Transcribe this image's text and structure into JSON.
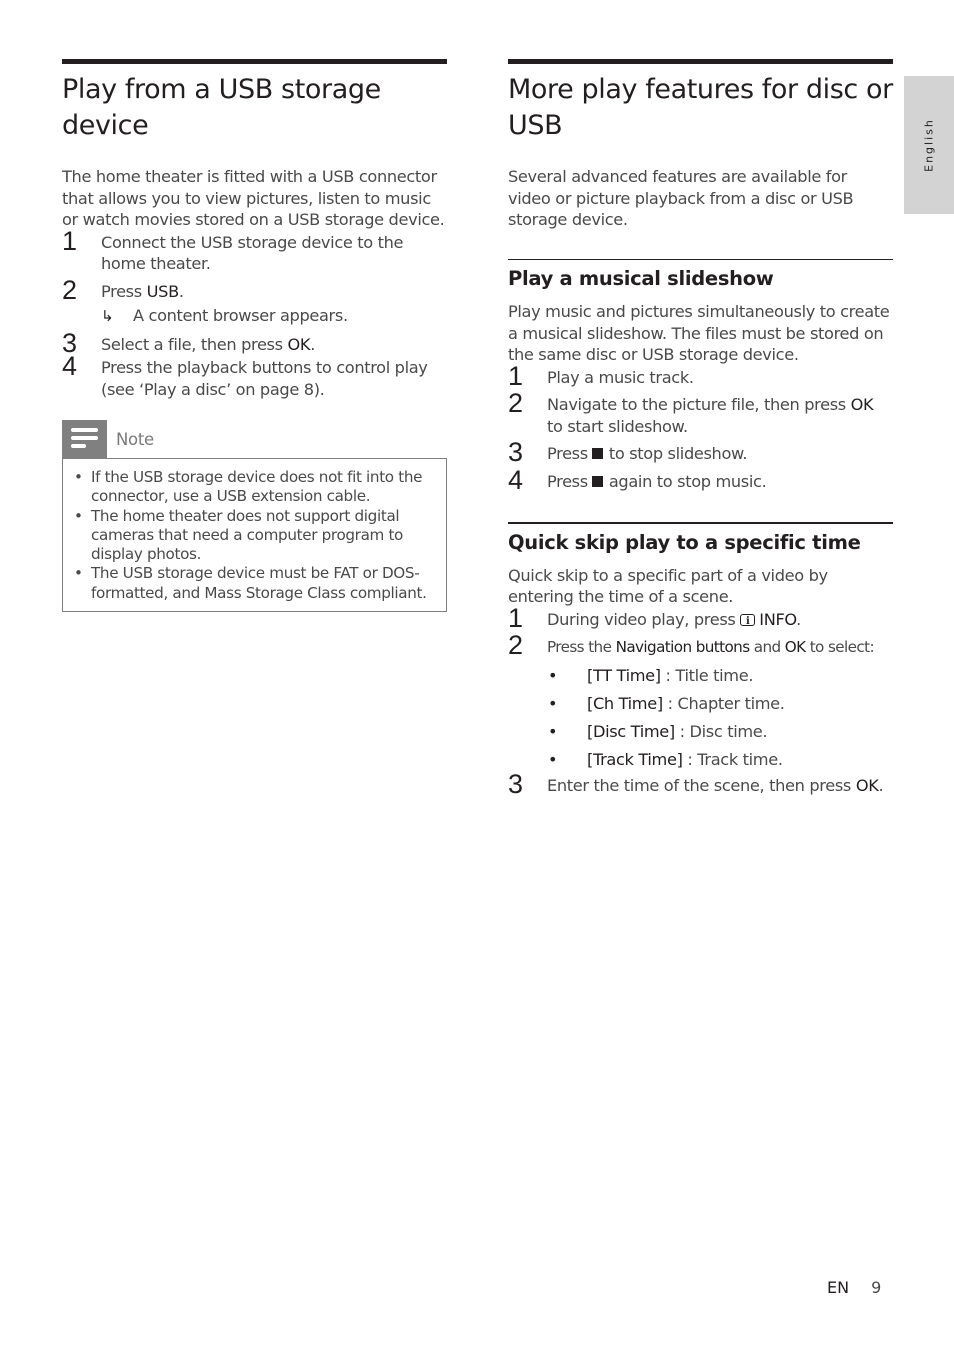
{
  "left": {
    "title": "Play from a USB storage device",
    "intro": "The home theater is fitted with a USB connector that allows you to view pictures, listen to music or watch movies stored on a USB storage device.",
    "steps": [
      {
        "num": "1",
        "text": "Connect the USB storage device to the home theater."
      },
      {
        "num": "2",
        "pre": "Press ",
        "bold": "USB",
        "post": ".",
        "result": "A content browser appears."
      },
      {
        "num": "3",
        "pre": "Select a file, then press ",
        "bold": "OK",
        "post": "."
      },
      {
        "num": "4",
        "text": "Press the playback buttons to control play (see ‘Play a disc’ on page 8)."
      }
    ],
    "note": {
      "label": "Note",
      "icon": "note-lines-icon",
      "items": [
        "If the USB storage device does not fit into the connector, use a USB extension cable.",
        "The home theater does not support digital cameras that need a computer program to display photos.",
        "The USB storage device must be FAT or DOS-formatted, and Mass Storage Class compliant."
      ]
    }
  },
  "right": {
    "title": "More play features for disc or USB",
    "intro": "Several advanced features are available for video or picture playback from a disc or USB storage device.",
    "slideshow": {
      "heading": "Play a musical slideshow",
      "intro": "Play music and pictures simultaneously to create a musical slideshow. The files must be stored on the same disc or USB storage device.",
      "steps": [
        {
          "num": "1",
          "text": "Play a music track."
        },
        {
          "num": "2",
          "pre": "Navigate to the picture file, then press ",
          "bold": "OK",
          "post": " to start slideshow."
        },
        {
          "num": "3",
          "pre": "Press",
          "icon": "stop-icon",
          "post": "to stop slideshow."
        },
        {
          "num": "4",
          "pre": "Press",
          "icon": "stop-icon",
          "post": "again to stop music."
        }
      ]
    },
    "quickskip": {
      "heading": "Quick skip play to a specific time",
      "intro": "Quick skip to a specific part of a video by entering the time of a scene.",
      "steps": [
        {
          "num": "1",
          "pre": "During video play, press ",
          "icon": "info-icon",
          "bold": "INFO",
          "post": "."
        },
        {
          "num": "2",
          "pre": "Press the ",
          "bold1": "Navigation buttons",
          "mid": " and ",
          "bold2": "OK",
          "post": " to select:"
        },
        {
          "num": "3",
          "pre": "Enter the time of the scene, then press ",
          "bold": "OK",
          "post": "."
        }
      ],
      "options": [
        {
          "bold": "[TT Time]",
          "text": " : Title time."
        },
        {
          "bold": "[Ch Time]",
          "text": " : Chapter time."
        },
        {
          "bold": "[Disc Time]",
          "text": " : Disc time."
        },
        {
          "bold": "[Track Time]",
          "text": " : Track time."
        }
      ]
    }
  },
  "side_tab": {
    "label": "English"
  },
  "footer": {
    "lang": "EN",
    "page": "9"
  }
}
